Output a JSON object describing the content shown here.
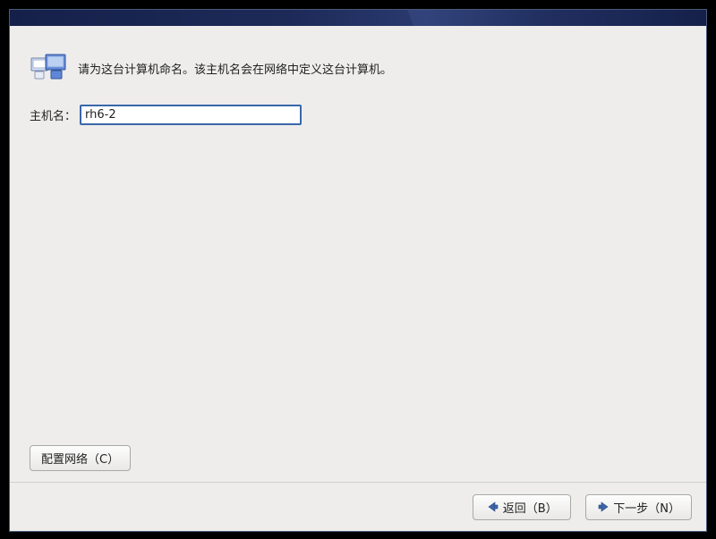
{
  "intro": {
    "text": "请为这台计算机命名。该主机名会在网络中定义这台计算机。"
  },
  "hostname": {
    "label": "主机名：",
    "value": "rh6-2"
  },
  "buttons": {
    "configure_network": "配置网络（C）",
    "back": "返回（B）",
    "next": "下一步（N）"
  }
}
